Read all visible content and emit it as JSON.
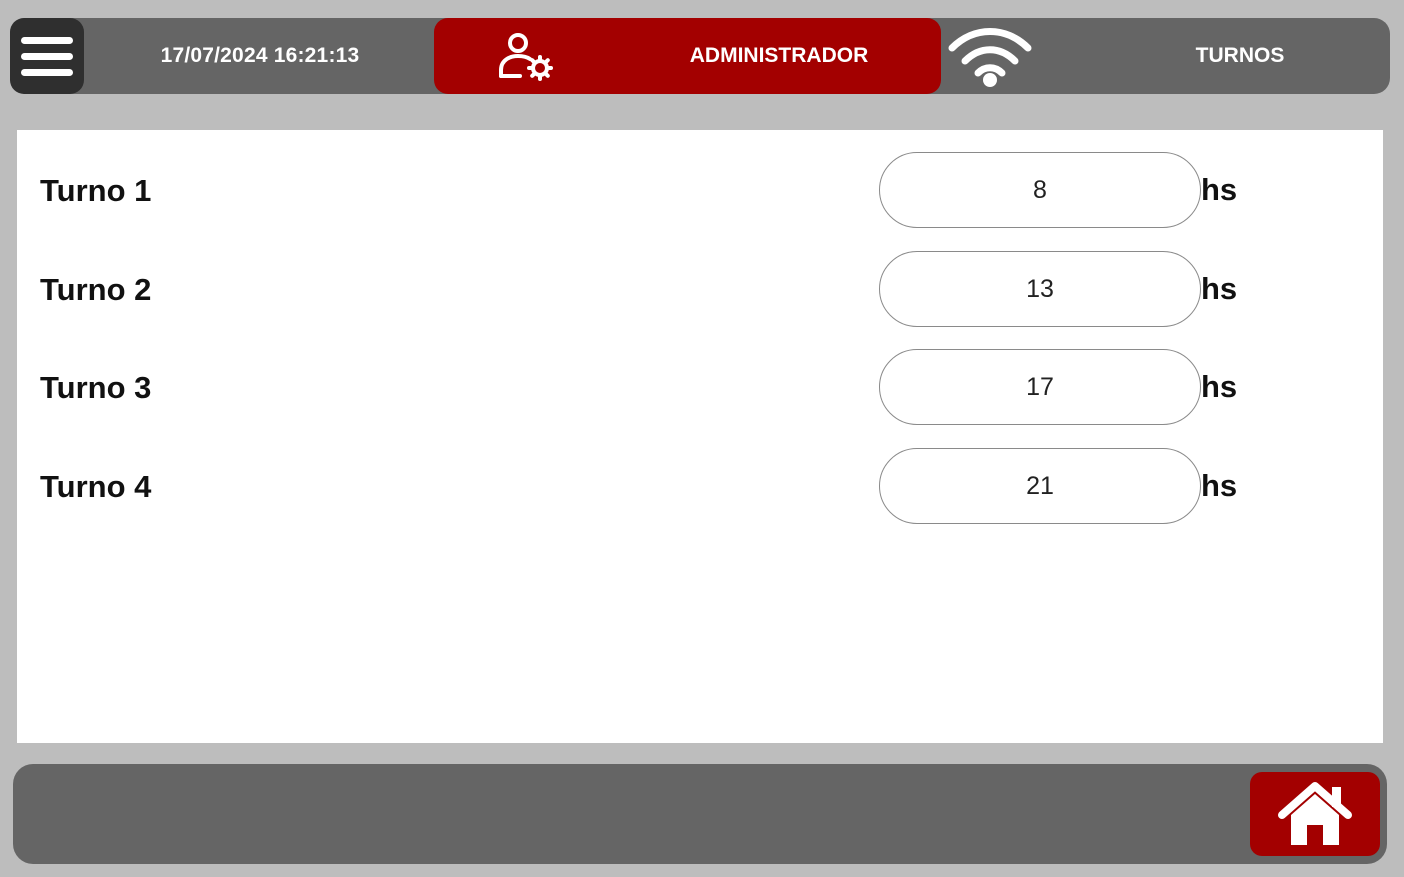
{
  "header": {
    "menu_icon": "hamburger-menu-icon",
    "datetime": "17/07/2024 16:21:13",
    "user_icon": "user-settings-icon",
    "user_role": "ADMINISTRADOR",
    "wifi_icon": "wifi-icon",
    "screen_title": "TURNOS"
  },
  "turnos": [
    {
      "label": "Turno 1",
      "value": "8",
      "unit": "hs"
    },
    {
      "label": "Turno 2",
      "value": "13",
      "unit": "hs"
    },
    {
      "label": "Turno 3",
      "value": "17",
      "unit": "hs"
    },
    {
      "label": "Turno 4",
      "value": "21",
      "unit": "hs"
    }
  ],
  "footer": {
    "home_icon": "home-icon"
  },
  "colors": {
    "accent": "#a30000",
    "bar": "#656565",
    "background": "#bdbdbd",
    "panel": "#ffffff"
  }
}
